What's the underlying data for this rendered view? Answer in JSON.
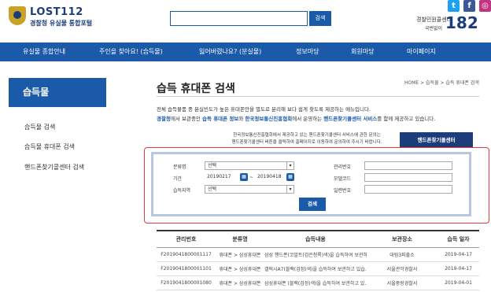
{
  "header": {
    "site_name": "LOST112",
    "site_subtitle": "경찰청 유실물 통합포털",
    "search_button": "검색",
    "search_value": "",
    "sns": [
      "t",
      "f",
      "◎"
    ],
    "call_label": "경찰민원콜센터",
    "call_sub": "국번없이",
    "call_number": "182"
  },
  "nav": {
    "items": [
      "유실물 종합안내",
      "주인을 찾아요! (습득물)",
      "잃어버렸나요? (분실물)",
      "정보마당",
      "회원마당",
      "마이페이지"
    ]
  },
  "sidebar": {
    "title": "습득물",
    "items": [
      "습득물 검색",
      "습득물 휴대폰 검색",
      "핸드폰찾기콜센터 검색"
    ]
  },
  "main": {
    "title": "습득 휴대폰 검색",
    "breadcrumb": "HOME > 습득물 > 습득 휴대폰 검색",
    "desc1": "전체 습득물품 중 분실빈도가 높은 휴대폰만을 별도로 분리해 보다 쉽게 찾도록 제공하는 메뉴입니다.",
    "desc2_a": "경찰청",
    "desc2_b": "에서 보관중인 ",
    "desc2_c": "습득 휴대폰 정보",
    "desc2_d": "와 ",
    "desc2_e": "한국정보통신진흥협회",
    "desc2_f": "에서 운영하는 ",
    "desc2_g": "핸드폰찾기콜센터 서비스",
    "desc2_h": "를 함께 제공하고 있습니다.",
    "notice1": "한국정보통신진흥협회에서 제공하고 있는 핸드폰찾기콜센터 서비스에 관한 문의는",
    "notice2": "핸드폰찾기콜센터 버튼을 클릭하여 홈페이지로 이동하여 문의하여 주시기 바랍니다.",
    "center_button": "핸드폰찾기콜센터"
  },
  "form": {
    "category_label": "분류명",
    "category_value": "선택",
    "period_label": "기간",
    "date_from": "20190217",
    "date_sep": "~",
    "date_to": "20190418",
    "region_label": "습득지역",
    "region_value": "선택",
    "manage_no_label": "관리번호",
    "model_code_label": "모델코드",
    "serial_label": "일련번호",
    "search_button": "검색"
  },
  "table": {
    "headers": [
      "관리번호",
      "분류명",
      "습득내용",
      "보관장소",
      "습득 일자"
    ],
    "rows": [
      [
        "F2019041800001117",
        "휴대폰 > 삼성휴대폰",
        "삼성 핸드폰(코발트(검은청록)색)을 습득하여 보관하...",
        "대림3파출소",
        "2019-04-17"
      ],
      [
        "F2019041800001101",
        "휴대폰 > 삼성휴대폰",
        "갤럭시A7(블랙(검정)색)을 습득하여 보관하고 있습...",
        "서울관악경찰서",
        "2019-04-17"
      ],
      [
        "F2019041800001080",
        "휴대폰 > 삼성휴대폰",
        "삼성휴대폰 (블랙(검정)색)을 습득하여 보관하고 있...",
        "서울중랑경찰서",
        "2019-04-01"
      ]
    ]
  },
  "colors": {
    "primary": "#1b5aa8",
    "dark": "#1b3e7a",
    "highlight": "#e23b3b"
  }
}
